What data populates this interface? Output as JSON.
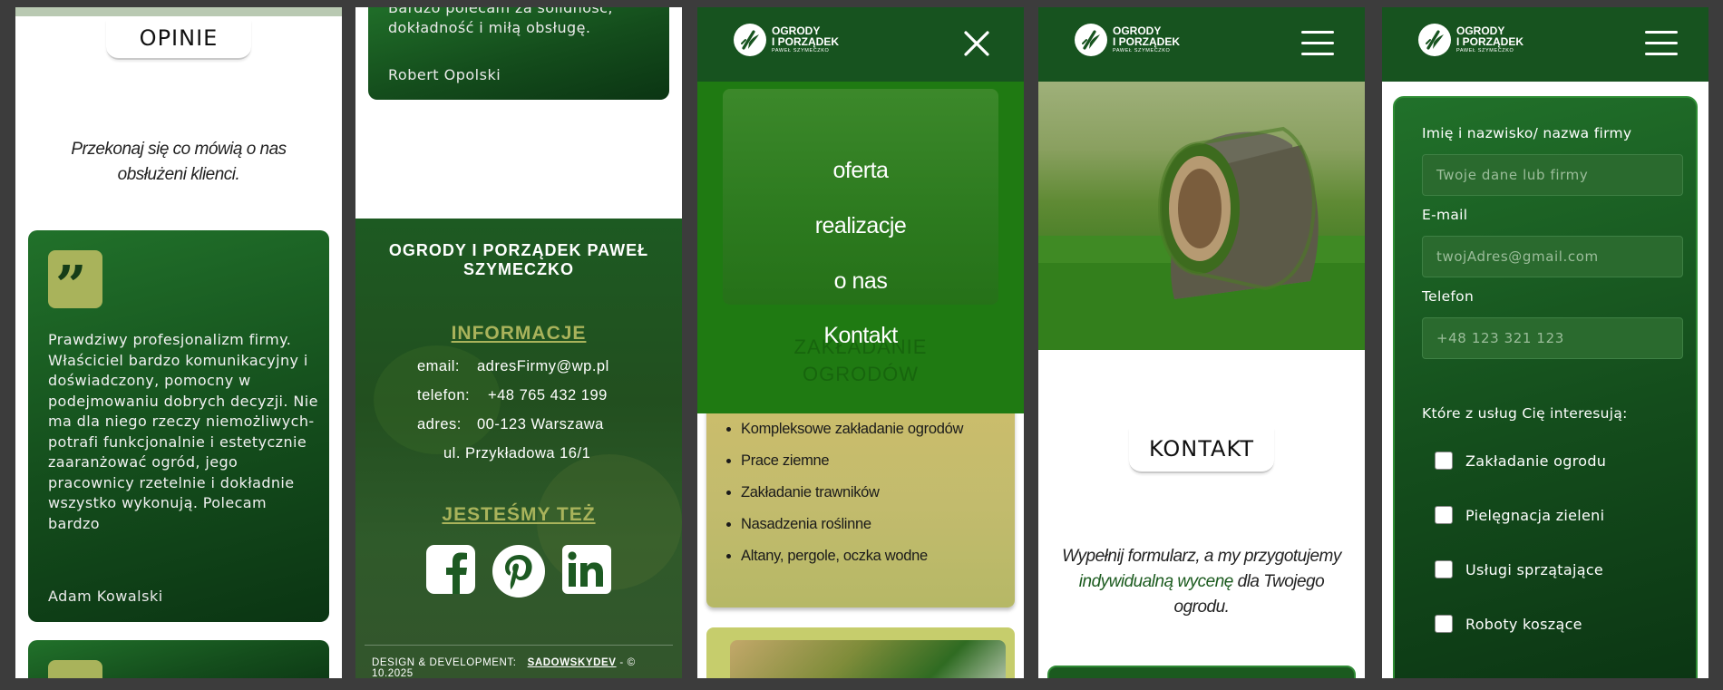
{
  "brand": {
    "logo_line1": "OGRODY",
    "logo_line2": "I PORZĄDEK",
    "logo_line3": "PAWEŁ SZYMECZKO"
  },
  "screen1": {
    "section_title": "OPINIE",
    "lead": "Przekonaj się co mówią o nas obsłużeni klienci.",
    "reviews": [
      {
        "text": "Prawdziwy profesjonalizm firmy. Właściciel bardzo komunikacyjny i doświadczony, pomocny w podejmowaniu dobrych decyzji. Nie ma dla niego rzeczy niemożliwych- potrafi funkcjonalnie i estetycznie zaaranżować ogród, jego pracownicy rzetelnie i dokładnie wszystko wykonują. Polecam bardzo",
        "author": "Adam Kowalski"
      }
    ]
  },
  "screen2": {
    "review_line1": "Bardzo polecam za solidność,",
    "review_line2": "dokładność i miłą obsługę.",
    "review_author": "Robert Opolski",
    "footer_title": "OGRODY I PORZĄDEK PAWEŁ SZYMECZKO",
    "info_heading": "INFORMACJE",
    "email_label": "email:",
    "email_value": "adresFirmy@wp.pl",
    "phone_label": "telefon:",
    "phone_value": "+48 765 432 199",
    "address_label": "adres:",
    "address_line1": "00-123 Warszawa",
    "address_line2": "ul. Przykładowa 16/1",
    "social_heading": "JESTEŚMY TEŻ",
    "credits_label": "DESIGN & DEVELOPMENT:",
    "credits_brand": "SADOWSKYDEV",
    "credits_suffix": "- © 10.2025"
  },
  "screen3": {
    "menu": [
      "oferta",
      "realizacje",
      "o nas",
      "Kontakt"
    ],
    "ghost_title_line1": "ZAKŁADANIE",
    "ghost_title_line2": "OGRODÓW",
    "services": [
      "Kompleksowe zakładanie ogrodów",
      "Prace ziemne",
      "Zakładanie trawników",
      "Nasadzenia roślinne",
      "Altany, pergole, oczka wodne"
    ]
  },
  "screen4": {
    "section_title": "KONTAKT",
    "lead_part1": "Wypełnij formularz, a my przygotujemy",
    "lead_highlight": "indywidualną wycenę",
    "lead_part2": "dla Twojego ogrodu."
  },
  "screen5": {
    "name_label": "Imię i nazwisko/ nazwa firmy",
    "name_placeholder": "Twoje dane lub firmy",
    "email_label": "E-mail",
    "email_placeholder": "twojAdres@gmail.com",
    "phone_label": "Telefon",
    "phone_placeholder": "+48 123 321 123",
    "services_label": "Które z usług Cię interesują:",
    "service_options": [
      "Zakładanie ogrodu",
      "Pielęgnacja zieleni",
      "Usługi sprzątające",
      "Roboty koszące"
    ]
  },
  "colors": {
    "brand_green": "#17531f",
    "accent_olive": "#a9b35b",
    "menu_green": "#1f7a12"
  }
}
